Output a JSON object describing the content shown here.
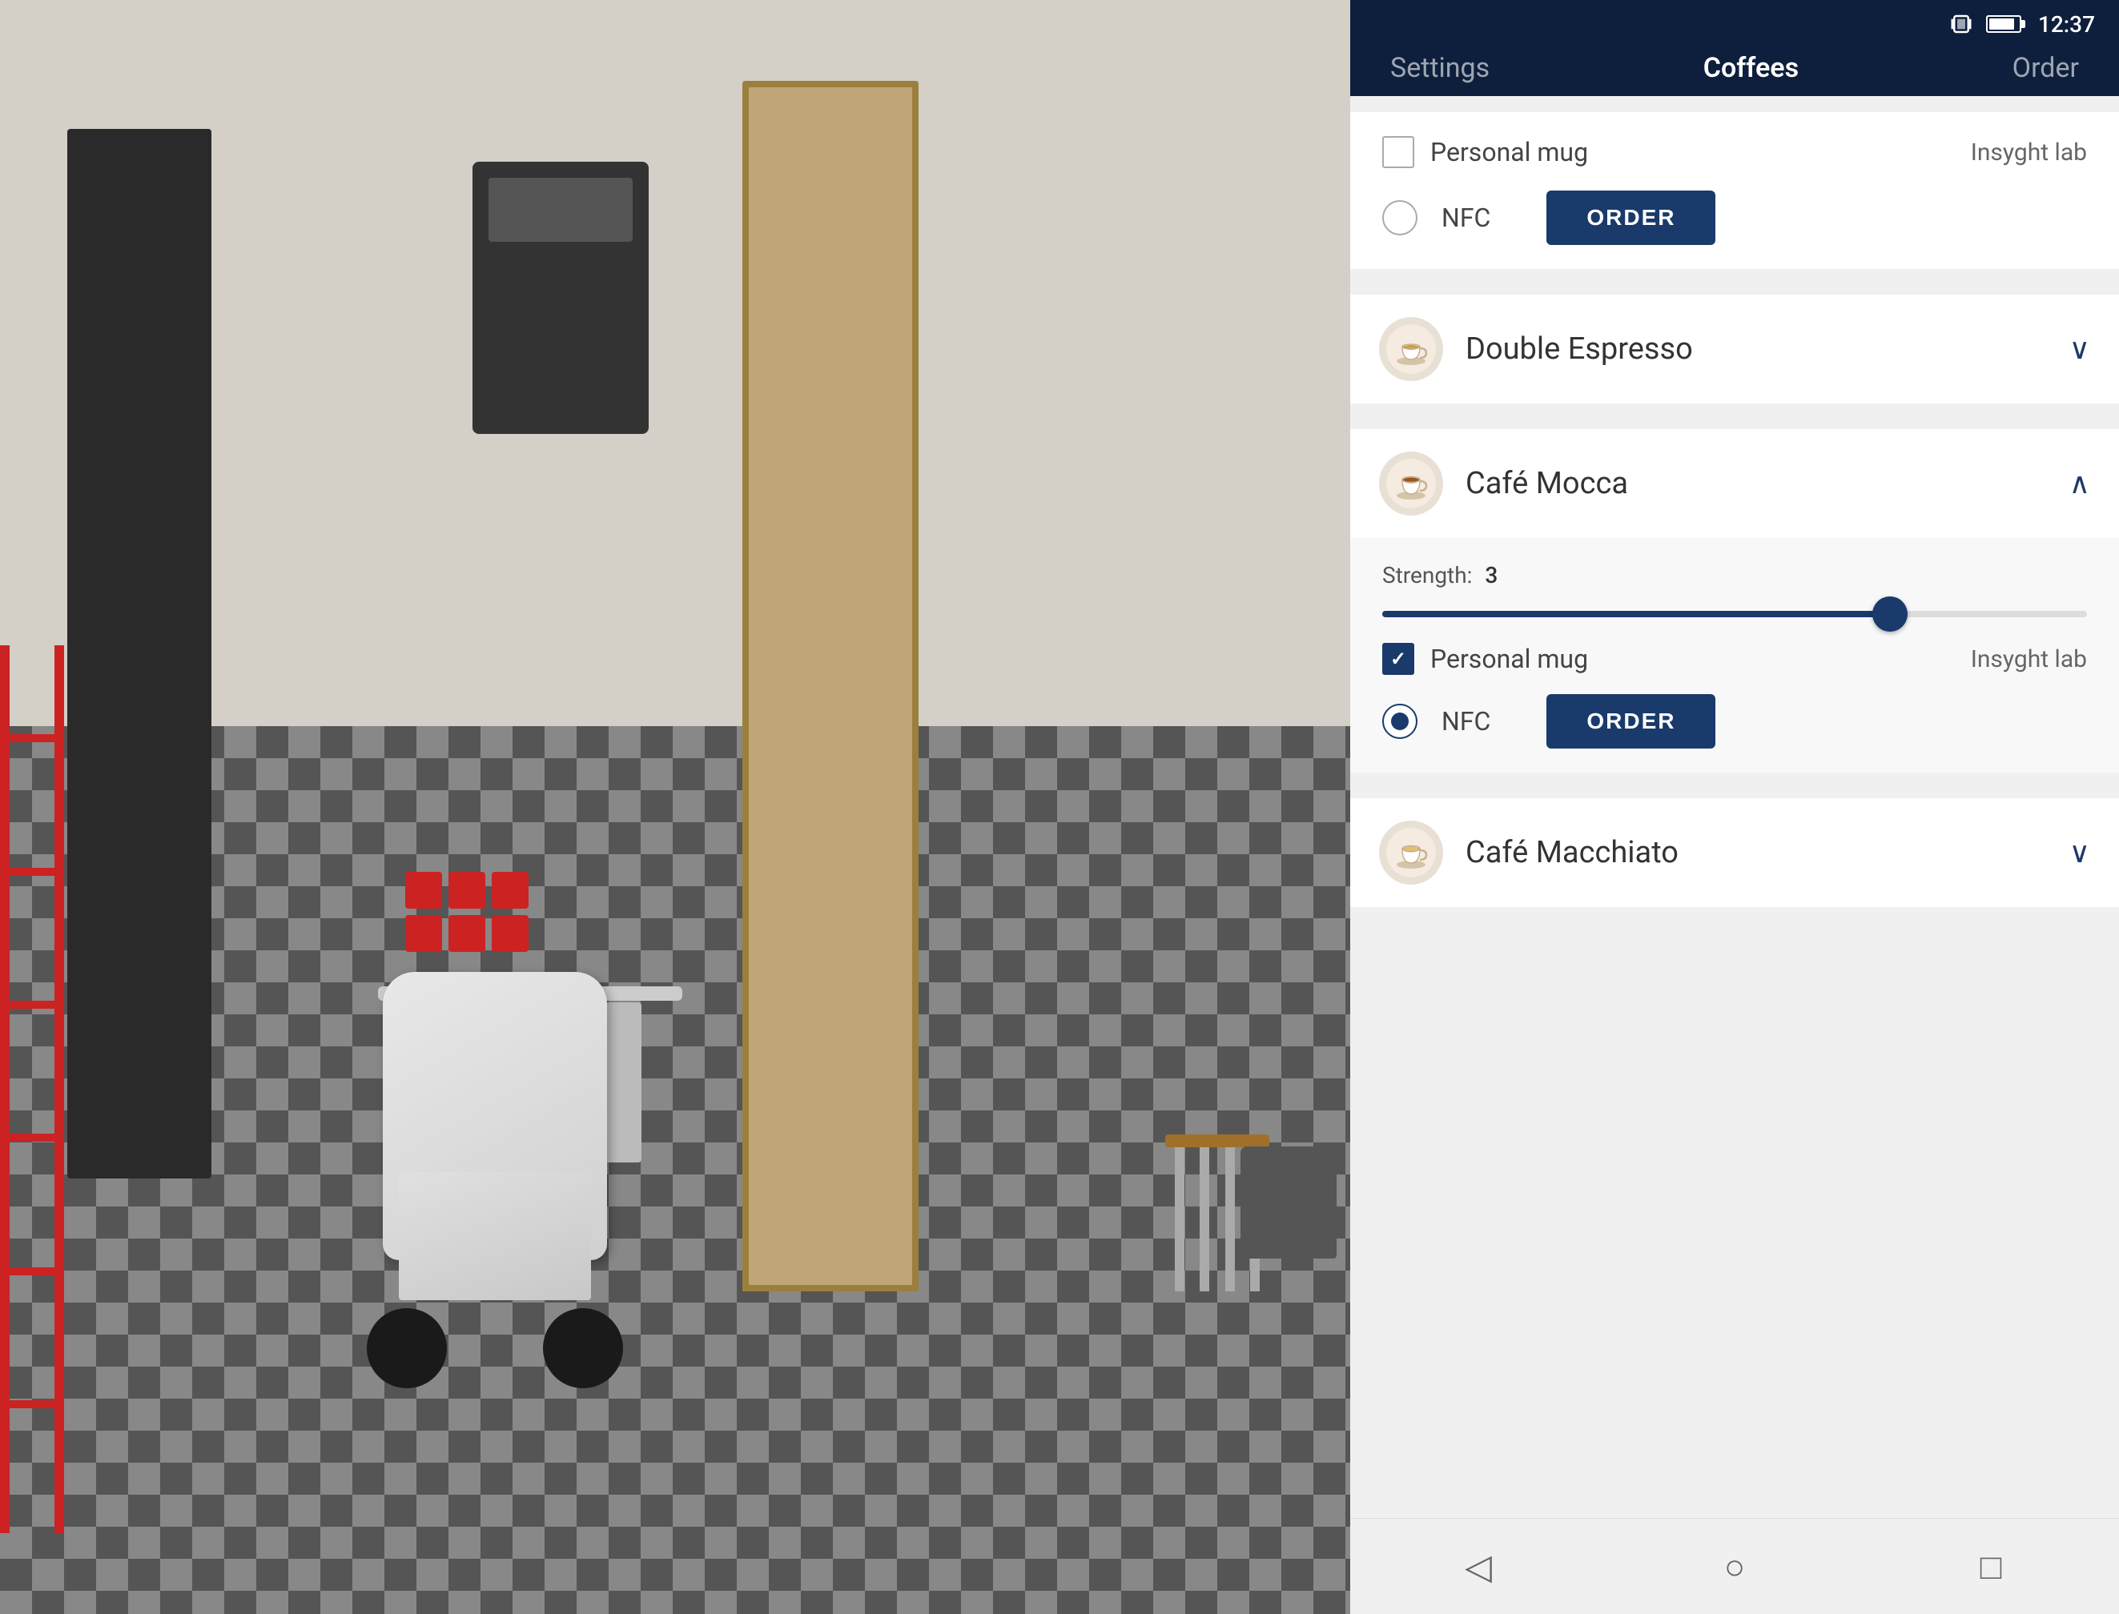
{
  "statusBar": {
    "time": "12:37"
  },
  "nav": {
    "tabs": [
      {
        "id": "settings",
        "label": "Settings",
        "active": false
      },
      {
        "id": "coffees",
        "label": "Coffees",
        "active": true
      },
      {
        "id": "order",
        "label": "Order",
        "active": false
      }
    ]
  },
  "topCard": {
    "personalMug": {
      "label": "Personal mug",
      "checked": false,
      "location": "Insyght lab"
    },
    "nfc": {
      "label": "NFC",
      "checked": false
    },
    "orderButton": "ORDER"
  },
  "coffeeItems": [
    {
      "id": "double-espresso",
      "name": "Double Espresso",
      "expanded": false,
      "chevron": "∨"
    },
    {
      "id": "cafe-mocca",
      "name": "Café Mocca",
      "expanded": true,
      "chevron": "∧",
      "strength": {
        "label": "Strength:",
        "value": "3",
        "percent": 72
      },
      "personalMug": {
        "label": "Personal mug",
        "checked": true,
        "location": "Insyght lab"
      },
      "nfc": {
        "label": "NFC",
        "checked": true
      },
      "orderButton": "ORDER"
    },
    {
      "id": "cafe-macchiato",
      "name": "Café Macchiato",
      "expanded": false,
      "chevron": "∨"
    }
  ],
  "bottomNav": {
    "back": "◁",
    "home": "○",
    "recents": "□"
  }
}
